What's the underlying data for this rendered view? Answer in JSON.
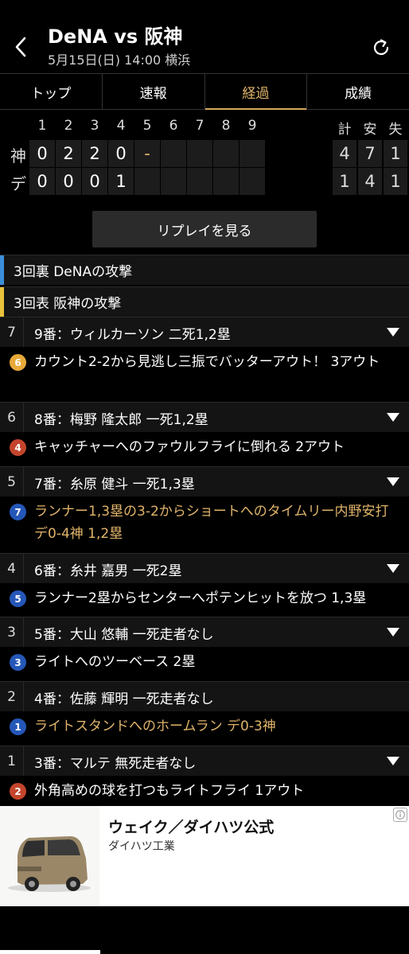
{
  "header": {
    "title": "DeNA vs 阪神",
    "subtitle": "5月15日(日) 14:00 横浜"
  },
  "tabs": [
    {
      "label": "トップ",
      "active": false
    },
    {
      "label": "速報",
      "active": false
    },
    {
      "label": "経過",
      "active": true
    },
    {
      "label": "成績",
      "active": false
    }
  ],
  "scoreboard": {
    "innings": [
      "1",
      "2",
      "3",
      "4",
      "5",
      "6",
      "7",
      "8",
      "9"
    ],
    "totals_headers": [
      "計",
      "安",
      "失"
    ],
    "teams": [
      {
        "name": "神",
        "scores": [
          "0",
          "2",
          "2",
          "0",
          "-",
          "",
          "",
          "",
          ""
        ],
        "totals": [
          "4",
          "7",
          "1"
        ]
      },
      {
        "name": "デ",
        "scores": [
          "0",
          "0",
          "0",
          "1",
          "",
          "",
          "",
          "",
          ""
        ],
        "totals": [
          "1",
          "4",
          "1"
        ]
      }
    ]
  },
  "replay_button": "リプレイを見る",
  "innings": [
    {
      "label": "3回裏 DeNAの攻撃",
      "stripe_color": "#3b8fd9"
    },
    {
      "label": "3回表 阪神の攻撃",
      "stripe_color": "#e8c23a"
    }
  ],
  "events": [
    {
      "num": "7",
      "batter": "9番：ウィルカーソン 二死1,2塁",
      "play_num": "6",
      "badge_color": "#e8a93a",
      "play": "カウント2-2から見逃し三振でバッターアウト！ 3アウト",
      "highlight": false
    },
    {
      "num": "6",
      "batter": "8番：梅野 隆太郎 一死1,2塁",
      "play_num": "4",
      "badge_color": "#c4452c",
      "play": "キャッチャーへのファウルフライに倒れる 2アウト",
      "highlight": false
    },
    {
      "num": "5",
      "batter": "7番：糸原 健斗 一死1,3塁",
      "play_num": "7",
      "badge_color": "#2557b8",
      "play": "ランナー1,3塁の3-2からショートへのタイムリー内野安打 デ0-4神 1,2塁",
      "highlight": true
    },
    {
      "num": "4",
      "batter": "6番：糸井 嘉男 一死2塁",
      "play_num": "5",
      "badge_color": "#2557b8",
      "play": "ランナー2塁からセンターへポテンヒットを放つ 1,3塁",
      "highlight": false
    },
    {
      "num": "3",
      "batter": "5番：大山 悠輔 一死走者なし",
      "play_num": "3",
      "badge_color": "#2557b8",
      "play": "ライトへのツーベース 2塁",
      "highlight": false
    },
    {
      "num": "2",
      "batter": "4番：佐藤 輝明 一死走者なし",
      "play_num": "1",
      "badge_color": "#2557b8",
      "play": "ライトスタンドへのホームラン デ0-3神",
      "highlight": true
    },
    {
      "num": "1",
      "batter": "3番：マルテ 無死走者なし",
      "play_num": "2",
      "badge_color": "#c4452c",
      "play": "外角高めの球を打つもライトフライ 1アウト",
      "highlight": false
    }
  ],
  "ad": {
    "title": "ウェイク／ダイハツ公式",
    "advertiser": "ダイハツ工業"
  }
}
